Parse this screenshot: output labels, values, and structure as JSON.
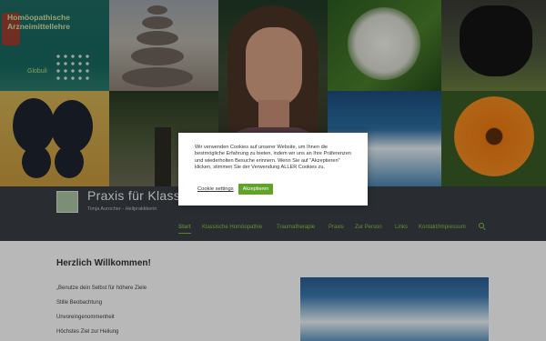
{
  "collage": {
    "book_title": "Homöopathische Arzneimittellehre",
    "book_sub": "Globuli"
  },
  "header": {
    "site_title": "Praxis für Klassis",
    "tagline": "Tonja Aurocher - Heilpraktikerin"
  },
  "nav": {
    "items": [
      {
        "label": "Start",
        "active": true
      },
      {
        "label": "Klassische Homöopathie"
      },
      {
        "label": "Traumatherapie"
      },
      {
        "label": "Praxis"
      },
      {
        "label": "Zur Person"
      },
      {
        "label": "Links"
      },
      {
        "label": "Kontakt/Impressum"
      }
    ],
    "search_icon": "search-icon",
    "accent": "#8bc34a"
  },
  "main": {
    "heading": "Herzlich Willkommen!",
    "lines": [
      "„Benutze dein Selbst für höhere Ziele",
      "Stille Beobachtung",
      "Unvoreingenommenheit",
      "Höchstes Ziel zur Heilung"
    ]
  },
  "cookie": {
    "text": "Wir verwenden Cookies auf unserer Website, um Ihnen die bestmögliche Erfahrung zu bieten, indem wir uns an Ihre Präferenzen und wiederholten Besuche erinnern. Wenn Sie auf \"Akzeptieren\" klicken, stimmen Sie der Verwendung ALLER Cookies zu.",
    "settings_label": "Cookie settings",
    "accept_label": "Akzeptieren",
    "accept_color": "#61a229"
  }
}
